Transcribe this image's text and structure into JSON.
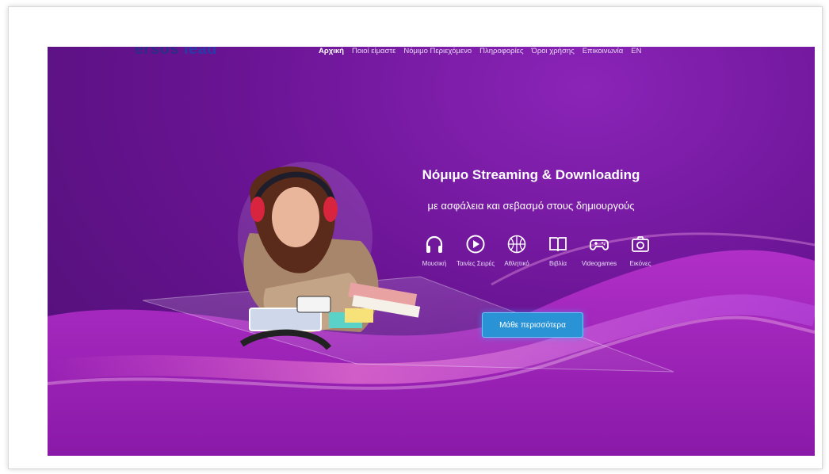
{
  "logo": {
    "text": "ersos ",
    "accent": "lead"
  },
  "nav": {
    "items": [
      {
        "label": "Αρχική",
        "active": true
      },
      {
        "label": "Ποιοί είμαστε",
        "active": false
      },
      {
        "label": "Νόμιμο Περιεχόμενο",
        "active": false
      },
      {
        "label": "Πληροφορίες",
        "active": false
      },
      {
        "label": "Όροι χρήσης",
        "active": false
      },
      {
        "label": "Επικοινωνία",
        "active": false
      },
      {
        "label": "EN",
        "active": false
      }
    ]
  },
  "hero": {
    "title": "Νόμιμο Streaming & Downloading",
    "subtitle": "με ασφάλεια και σεβασμό στους δημιουργούς",
    "categories": [
      {
        "icon": "headphones-icon",
        "label": "Μουσική"
      },
      {
        "icon": "play-icon",
        "label": "Ταινίες Σειρές"
      },
      {
        "icon": "basketball-icon",
        "label": "Αθλητικό"
      },
      {
        "icon": "book-icon",
        "label": "Βιβλία"
      },
      {
        "icon": "gamepad-icon",
        "label": "Videogames"
      },
      {
        "icon": "camera-icon",
        "label": "Εικόνες"
      }
    ],
    "cta_label": "Μάθε περισσότερα"
  },
  "colors": {
    "accent": "#2a93d6",
    "background": "#6a1494"
  }
}
